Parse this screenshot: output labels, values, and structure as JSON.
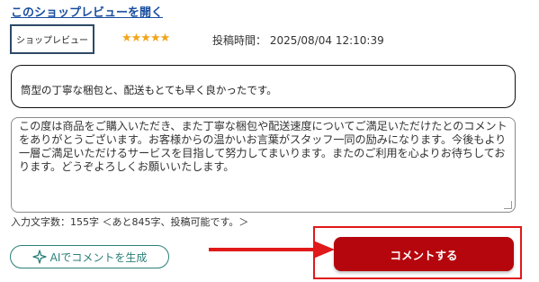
{
  "header": {
    "open_reviews_link": "このショップレビューを開く"
  },
  "review": {
    "type_badge": "ショップレビュー",
    "rating_stars": "★★★★★",
    "rating": 5,
    "star_color": "#f2a51a",
    "posted_label": "投稿時間：",
    "posted_at": "2025/08/04 12:10:39",
    "text": "筒型の丁寧な梱包と、配送もとても早く良かったです。"
  },
  "reply": {
    "text": "この度は商品をご購入いただき、また丁寧な梱包や配送速度についてご満足いただけたとのコメントをありがとうございます。お客様からの温かいお言葉がスタッフ一同の励みになります。今後もより一層ご満足いただけるサービスを目指して努力してまいります。またのご利用を心よりお待ちしております。どうぞよろしくお願いいたします。",
    "char_count_text": "入力文字数：155字 ＜あと845字、投稿可能です。＞",
    "char_count": 155,
    "remaining": 845
  },
  "actions": {
    "ai_button_label": "AIでコメントを生成",
    "ai_icon": "ai-sparkle-icon",
    "submit_button_label": "コメントする",
    "submit_color": "#b5060d",
    "highlight_color": "#e0191a",
    "arrow_color": "#e0191a"
  }
}
